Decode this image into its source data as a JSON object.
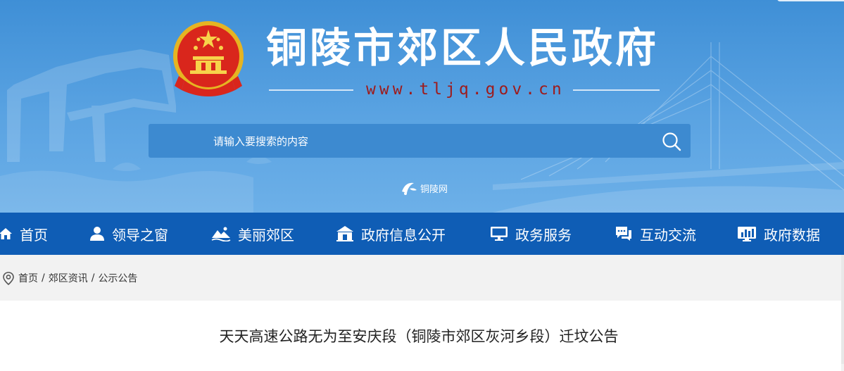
{
  "header": {
    "site_title": "铜陵市郊区人民政府",
    "site_url": "www.tljq.gov.cn",
    "search_placeholder": "请输入要搜索的内容",
    "partner_logo_text": "铜陵网"
  },
  "nav": {
    "items": [
      {
        "label": "首页",
        "icon": "home-icon"
      },
      {
        "label": "领导之窗",
        "icon": "user-icon"
      },
      {
        "label": "美丽郊区",
        "icon": "landscape-icon"
      },
      {
        "label": "政府信息公开",
        "icon": "government-building-icon"
      },
      {
        "label": "政务服务",
        "icon": "monitor-icon"
      },
      {
        "label": "互动交流",
        "icon": "chat-icon"
      },
      {
        "label": "政府数据",
        "icon": "data-chart-icon"
      }
    ]
  },
  "breadcrumb": {
    "items": [
      "首页",
      "郊区资讯",
      "公示公告"
    ],
    "separator": "/"
  },
  "article": {
    "title": "天天高速公路无为至安庆段（铜陵市郊区灰河乡段）迁坟公告"
  },
  "colors": {
    "banner_blue": "#4b98dc",
    "nav_blue": "#0f5db5",
    "url_red": "#9e1b1b",
    "page_bg": "#f2f2f2"
  }
}
